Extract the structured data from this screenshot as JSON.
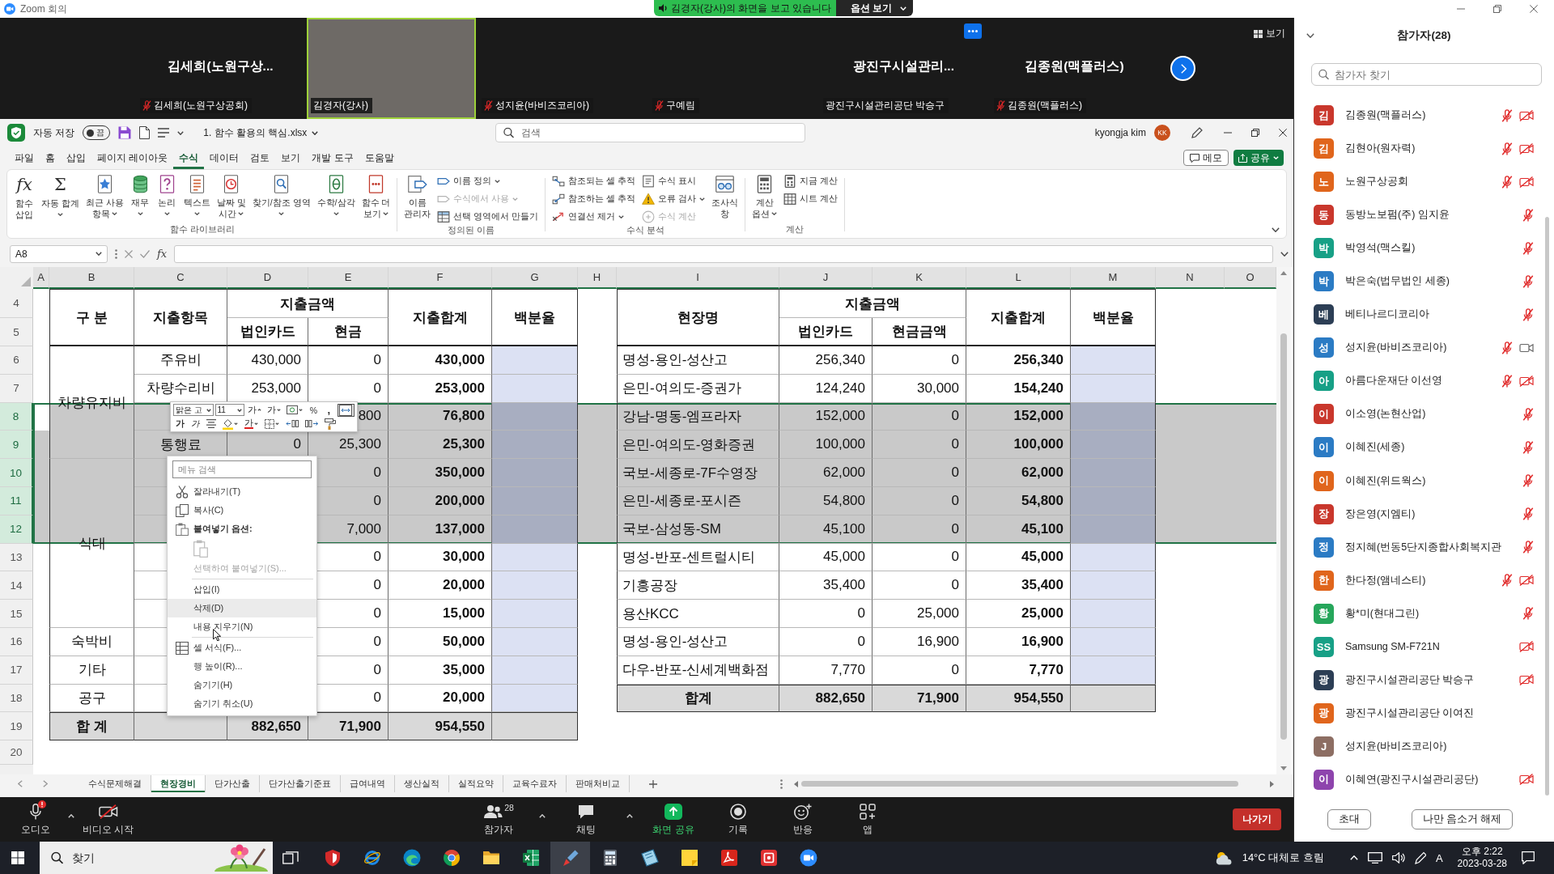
{
  "zoom_window": {
    "title": "Zoom 회의",
    "share_banner": "김경자(강사)의 화면을 보고 있습니다",
    "view_options": "옵션 보기"
  },
  "video_strip": {
    "tiles": [
      {
        "kind": "name",
        "display_name": "김세희(노원구상...",
        "label": "김세희(노원구상공회)",
        "muted": true,
        "speaking": false,
        "menu": false
      },
      {
        "kind": "video",
        "label": "김경자(강사)",
        "muted": false,
        "speaking": true,
        "menu": false
      },
      {
        "kind": "blank",
        "label": "성지윤(바비즈코리아)",
        "muted": true,
        "speaking": false,
        "menu": false
      },
      {
        "kind": "blank",
        "label": "구예림",
        "muted": true,
        "speaking": false,
        "menu": false
      },
      {
        "kind": "name",
        "display_name": "광진구시설관리...",
        "label": "광진구시설관리공단 박승구",
        "muted": false,
        "speaking": false,
        "menu": true
      },
      {
        "kind": "name",
        "display_name": "김종원(맥플러스)",
        "label": "김종원(맥플러스)",
        "muted": true,
        "speaking": false,
        "menu": false
      }
    ],
    "view_button": "보기"
  },
  "excel": {
    "autosave_label": "자동 저장",
    "autosave": {
      "label": "끔",
      "on": false
    },
    "file_name": "1. 함수 활용의 핵심.xlsx",
    "search_placeholder": "검색",
    "user_name": "kyongja kim",
    "user_initials": "KK",
    "tabs": [
      {
        "label": "파일",
        "selected": false
      },
      {
        "label": "홈",
        "selected": false
      },
      {
        "label": "삽입",
        "selected": false
      },
      {
        "label": "페이지 레이아웃",
        "selected": false
      },
      {
        "label": "수식",
        "selected": true
      },
      {
        "label": "데이터",
        "selected": false
      },
      {
        "label": "검토",
        "selected": false
      },
      {
        "label": "보기",
        "selected": false
      },
      {
        "label": "개발 도구",
        "selected": false
      },
      {
        "label": "도움말",
        "selected": false
      }
    ],
    "comments_button": "메모",
    "share_button": "공유",
    "ribbon": {
      "groups": [
        {
          "label": "함수 라이브러리",
          "items": [
            {
              "kind": "large",
              "glyph": "fx",
              "lines": [
                "함수",
                "삽입"
              ],
              "dropdown": false,
              "disabled": false
            },
            {
              "kind": "large",
              "glyph": "Σ",
              "lines": [
                "자동 합계"
              ],
              "dropdown": true,
              "disabled": false
            },
            {
              "kind": "large",
              "lines": [
                "최근 사용",
                "항목"
              ],
              "dropdown": true,
              "disabled": false
            },
            {
              "kind": "large",
              "lines": [
                "재무"
              ],
              "dropdown": true,
              "disabled": false
            },
            {
              "kind": "large",
              "lines": [
                "논리"
              ],
              "dropdown": true,
              "disabled": false
            },
            {
              "kind": "large",
              "lines": [
                "텍스트"
              ],
              "dropdown": true,
              "disabled": false
            },
            {
              "kind": "large",
              "lines": [
                "날짜 및",
                "시간"
              ],
              "dropdown": true,
              "disabled": false
            },
            {
              "kind": "large",
              "lines": [
                "찾기/참조 영역"
              ],
              "dropdown": true,
              "disabled": false
            },
            {
              "kind": "large",
              "lines": [
                "수학/삼각"
              ],
              "dropdown": true,
              "disabled": false
            },
            {
              "kind": "large",
              "lines": [
                "함수 더",
                "보기"
              ],
              "dropdown": true,
              "disabled": false
            }
          ]
        },
        {
          "label": "정의된 이름",
          "items": [
            {
              "kind": "large",
              "lines": [
                "이름",
                "관리자"
              ],
              "dropdown": false,
              "disabled": false
            },
            {
              "kind": "small",
              "label": "이름 정의",
              "dropdown": true,
              "disabled": false
            },
            {
              "kind": "small",
              "label": "수식에서 사용",
              "dropdown": true,
              "disabled": true
            },
            {
              "kind": "small",
              "label": "선택 영역에서 만들기",
              "dropdown": false,
              "disabled": false
            }
          ]
        },
        {
          "label": "수식 분석",
          "items": [
            {
              "kind": "small",
              "label": "참조되는 셀 추적",
              "dropdown": false,
              "disabled": false
            },
            {
              "kind": "small",
              "label": "참조하는 셀 추적",
              "dropdown": false,
              "disabled": false
            },
            {
              "kind": "small",
              "label": "연결선 제거",
              "dropdown": true,
              "disabled": false
            },
            {
              "kind": "small",
              "label": "수식 표시",
              "dropdown": false,
              "disabled": false
            },
            {
              "kind": "small",
              "label": "오류 검사",
              "dropdown": true,
              "disabled": false
            },
            {
              "kind": "small",
              "label": "수식 계산",
              "dropdown": false,
              "disabled": true
            },
            {
              "kind": "large",
              "lines": [
                "조사식",
                "창"
              ],
              "dropdown": false,
              "disabled": false
            }
          ]
        },
        {
          "label": "계산",
          "items": [
            {
              "kind": "large",
              "lines": [
                "계산",
                "옵션"
              ],
              "dropdown": true,
              "disabled": false
            },
            {
              "kind": "small",
              "label": "지금 계산",
              "dropdown": false,
              "disabled": false
            },
            {
              "kind": "small",
              "label": "시트 계산",
              "dropdown": false,
              "disabled": false
            }
          ]
        }
      ]
    },
    "name_box": "A8",
    "fx_label": "fx",
    "sheet": {
      "columns": [
        "A",
        "B",
        "C",
        "D",
        "E",
        "F",
        "G",
        "H",
        "I",
        "J",
        "K",
        "L",
        "M",
        "N",
        "O"
      ],
      "rows": [
        {
          "label": "4",
          "selected": false
        },
        {
          "label": "5",
          "selected": false
        },
        {
          "label": "6",
          "selected": false
        },
        {
          "label": "7",
          "selected": false
        },
        {
          "label": "8",
          "selected": true
        },
        {
          "label": "9",
          "selected": true
        },
        {
          "label": "10",
          "selected": true
        },
        {
          "label": "11",
          "selected": true
        },
        {
          "label": "12",
          "selected": true
        },
        {
          "label": "13",
          "selected": false
        },
        {
          "label": "14",
          "selected": false
        },
        {
          "label": "15",
          "selected": false
        },
        {
          "label": "16",
          "selected": false
        },
        {
          "label": "17",
          "selected": false
        },
        {
          "label": "18",
          "selected": false
        },
        {
          "label": "19",
          "selected": false
        },
        {
          "label": "20",
          "selected": false
        }
      ],
      "left_table": {
        "headers": {
          "category": "구 분",
          "item": "지출항목",
          "amount": "지출금액",
          "card": "법인카드",
          "cash": "현금",
          "total": "지출합계",
          "ratio": "백분율"
        },
        "groups": [
          {
            "label": "차량유지비",
            "rows": [
              {
                "item": "주유비",
                "card": "430,000",
                "cash": "0",
                "total": "430,000"
              },
              {
                "item": "차량수리비",
                "card": "253,000",
                "cash": "0",
                "total": "253,000"
              },
              {
                "cash": "800",
                "total": "76,800"
              },
              {
                "item": "통행료",
                "card": "0",
                "cash": "25,300",
                "total": "25,300"
              }
            ]
          },
          {
            "label": "식대",
            "rows": [
              {
                "cash": "0",
                "total": "350,000"
              },
              {
                "cash": "0",
                "total": "200,000"
              },
              {
                "cash": "7,000",
                "total": "137,000"
              },
              {
                "cash": "0",
                "total": "30,000"
              },
              {
                "cash": "0",
                "total": "20,000"
              },
              {
                "cash": "0",
                "total": "15,000"
              }
            ]
          },
          {
            "label": "숙박비",
            "rows": [
              {
                "cash": "0",
                "total": "50,000"
              }
            ]
          },
          {
            "label": "기타",
            "rows": [
              {
                "cash": "0",
                "total": "35,000"
              }
            ]
          },
          {
            "label": "공구",
            "rows": [
              {
                "cash": "0",
                "total": "20,000"
              }
            ]
          }
        ],
        "total": {
          "label": "합 계",
          "card": "882,650",
          "cash": "71,900",
          "total": "954,550"
        }
      },
      "right_table": {
        "headers": {
          "site": "현장명",
          "amount": "지출금액",
          "card": "법인카드",
          "cash": "현금금액",
          "total": "지출합계",
          "ratio": "백분율"
        },
        "rows": [
          {
            "site": "명성-용인-성산고",
            "card": "256,340",
            "cash": "0",
            "total": "256,340"
          },
          {
            "site": "은민-여의도-증권가",
            "card": "124,240",
            "cash": "30,000",
            "total": "154,240"
          },
          {
            "site": "강남-명동-엠프라자",
            "card": "152,000",
            "cash": "0",
            "total": "152,000"
          },
          {
            "site": "은민-여의도-영화증권",
            "card": "100,000",
            "cash": "0",
            "total": "100,000"
          },
          {
            "site": "국보-세종로-7F수영장",
            "card": "62,000",
            "cash": "0",
            "total": "62,000"
          },
          {
            "site": "은민-세종로-포시즌",
            "card": "54,800",
            "cash": "0",
            "total": "54,800"
          },
          {
            "site": "국보-삼성동-SM",
            "card": "45,100",
            "cash": "0",
            "total": "45,100"
          },
          {
            "site": "명성-반포-센트럴시티",
            "card": "45,000",
            "cash": "0",
            "total": "45,000"
          },
          {
            "site": "기흥공장",
            "card": "35,400",
            "cash": "0",
            "total": "35,400"
          },
          {
            "site": "용산KCC",
            "card": "0",
            "cash": "25,000",
            "total": "25,000"
          },
          {
            "site": "명성-용인-성산고",
            "card": "0",
            "cash": "16,900",
            "total": "16,900"
          },
          {
            "site": "다우-반포-신세계백화점",
            "card": "7,770",
            "cash": "0",
            "total": "7,770"
          }
        ],
        "total": {
          "label": "합계",
          "card": "882,650",
          "cash": "71,900",
          "total": "954,550"
        }
      }
    },
    "mini_toolbar": {
      "font": "맑은 고",
      "size": "11",
      "row1": [
        {
          "label": "가",
          "on": false
        },
        {
          "label": "가",
          "on": false
        },
        {
          "on": false
        },
        {
          "label": "%",
          "on": false
        },
        {
          "label": ",",
          "on": false
        },
        {
          "on": true
        }
      ],
      "row2": [
        {
          "label": "가",
          "on": false
        },
        {
          "label": "가",
          "on": false
        },
        {
          "on": false
        },
        {
          "on": false
        },
        {
          "label": "가",
          "on": false
        },
        {
          "on": false
        },
        {
          "on": false
        },
        {
          "on": false
        },
        {
          "on": false
        }
      ]
    },
    "context_menu": {
      "items": [
        {
          "kind": "search",
          "placeholder": "메뉴 검색"
        },
        {
          "kind": "cut",
          "label": "잘라내기(T)",
          "disabled": false,
          "highlighted": false
        },
        {
          "kind": "copy",
          "label": "복사(C)",
          "disabled": false,
          "highlighted": false
        },
        {
          "kind": "paste-header",
          "label": "붙여넣기 옵션:",
          "disabled": false,
          "highlighted": false
        },
        {
          "kind": "paste-button",
          "disabled": true
        },
        {
          "kind": "command",
          "label": "선택하여 붙여넣기(S)...",
          "disabled": true,
          "highlighted": false
        },
        {
          "kind": "separator"
        },
        {
          "kind": "command",
          "label": "삽입(I)",
          "disabled": false,
          "highlighted": false
        },
        {
          "kind": "command",
          "label": "삭제(D)",
          "disabled": false,
          "highlighted": true
        },
        {
          "kind": "command",
          "label": "내용 지우기(N)",
          "disabled": false,
          "highlighted": false
        },
        {
          "kind": "separator"
        },
        {
          "kind": "format",
          "label": "셀 서식(F)...",
          "disabled": false,
          "highlighted": false
        },
        {
          "kind": "command",
          "label": "행 높이(R)...",
          "disabled": false,
          "highlighted": false
        },
        {
          "kind": "command",
          "label": "숨기기(H)",
          "disabled": false,
          "highlighted": false
        },
        {
          "kind": "command",
          "label": "숨기기 취소(U)",
          "disabled": false,
          "highlighted": false
        }
      ]
    },
    "sheet_tabs": [
      {
        "label": "수식문제해결",
        "selected": false
      },
      {
        "label": "현장경비",
        "selected": true
      },
      {
        "label": "단가산출",
        "selected": false
      },
      {
        "label": "단가산출기준표",
        "selected": false
      },
      {
        "label": "급여내역",
        "selected": false
      },
      {
        "label": "생산실적",
        "selected": false
      },
      {
        "label": "실적요약",
        "selected": false
      },
      {
        "label": "교육수료자",
        "selected": false
      },
      {
        "label": "판매처비교",
        "selected": false
      }
    ]
  },
  "meeting_controls": {
    "left": [
      {
        "kind": "audio",
        "label": "오디오",
        "menu": true
      },
      {
        "kind": "video",
        "label": "비디오 시작",
        "menu": false
      }
    ],
    "center": [
      {
        "kind": "participants",
        "label": "참가자",
        "count": "28",
        "menu": true
      },
      {
        "kind": "chat",
        "label": "채팅",
        "menu": true
      },
      {
        "kind": "share",
        "label": "화면 공유",
        "menu": false
      },
      {
        "kind": "record",
        "label": "기록",
        "menu": false
      },
      {
        "kind": "reactions",
        "label": "반응",
        "menu": false
      },
      {
        "kind": "apps",
        "label": "앱",
        "menu": false
      }
    ],
    "leave_button": "나가기"
  },
  "participants_panel": {
    "title": "참가자(28)",
    "search_placeholder": "참가자 찾기",
    "participants": [
      {
        "initial": "김",
        "name": "김종원(맥플러스)",
        "color": "#c9372c",
        "muted": true,
        "video_off": true,
        "video_on": false
      },
      {
        "initial": "김",
        "name": "김현아(원자력)",
        "color": "#e0651c",
        "muted": true,
        "video_off": true,
        "video_on": false
      },
      {
        "initial": "노",
        "name": "노원구상공회",
        "color": "#e0651c",
        "muted": true,
        "video_off": true,
        "video_on": false
      },
      {
        "initial": "동",
        "name": "동방노보펌(주) 임지윤",
        "color": "#c9372c",
        "muted": true,
        "video_off": false,
        "video_on": false
      },
      {
        "initial": "박",
        "name": "박영석(맥스킬)",
        "color": "#17a086",
        "muted": true,
        "video_off": false,
        "video_on": false
      },
      {
        "initial": "박",
        "name": "박은숙(법무법인 세종)",
        "color": "#2b7bc4",
        "muted": true,
        "video_off": false,
        "video_on": false
      },
      {
        "initial": "베",
        "name": "베티나르디코리아",
        "color": "#2c3e55",
        "muted": true,
        "video_off": false,
        "video_on": false
      },
      {
        "initial": "성",
        "name": "성지윤(바비즈코리아)",
        "color": "#2b7bc4",
        "muted": true,
        "video_off": false,
        "video_on": true
      },
      {
        "initial": "아",
        "name": "아름다운재단 이선영",
        "color": "#17a086",
        "muted": true,
        "video_off": true,
        "video_on": false
      },
      {
        "initial": "이",
        "name": "이소영(논현산업)",
        "color": "#c9372c",
        "muted": true,
        "video_off": false,
        "video_on": false
      },
      {
        "initial": "이",
        "name": "이혜진(세종)",
        "color": "#2b7bc4",
        "muted": true,
        "video_off": false,
        "video_on": false
      },
      {
        "initial": "이",
        "name": "이혜진(위드웍스)",
        "color": "#e0651c",
        "muted": true,
        "video_off": false,
        "video_on": false
      },
      {
        "initial": "장",
        "name": "장은영(지엠티)",
        "color": "#c9372c",
        "muted": true,
        "video_off": false,
        "video_on": false
      },
      {
        "initial": "정",
        "name": "정지혜(번동5단지종합사회복지관",
        "color": "#2b7bc4",
        "muted": true,
        "video_off": false,
        "video_on": false
      },
      {
        "initial": "한",
        "name": "한다정(앰네스티)",
        "color": "#e0651c",
        "muted": true,
        "video_off": true,
        "video_on": false
      },
      {
        "initial": "황",
        "name": "황*미(현대그린)",
        "color": "#26a65b",
        "muted": true,
        "video_off": false,
        "video_on": false
      },
      {
        "initial": "SS",
        "name": "Samsung SM-F721N",
        "color": "#17a086",
        "muted": false,
        "video_off": true,
        "video_on": false
      },
      {
        "initial": "광",
        "name": "광진구시설관리공단 박승구",
        "color": "#2c3e55",
        "muted": false,
        "video_off": true,
        "video_on": false
      },
      {
        "initial": "광",
        "name": "광진구시설관리공단 이여진",
        "color": "#e0651c",
        "muted": false,
        "video_off": false,
        "video_on": false
      },
      {
        "initial": "J",
        "name": "성지윤(바비즈코리아)",
        "color": "#8d6e63",
        "muted": false,
        "video_off": false,
        "video_on": false
      },
      {
        "initial": "이",
        "name": "이혜연(광진구시설관리공단)",
        "color": "#8e44ad",
        "muted": false,
        "video_off": true,
        "video_on": false
      }
    ],
    "buttons": [
      "초대",
      "나만 음소거 해제"
    ]
  },
  "taskbar": {
    "search_placeholder": "찾기",
    "apps": [
      {
        "active": false
      },
      {
        "active": false
      },
      {
        "active": false
      },
      {
        "active": false
      },
      {
        "active": false
      },
      {
        "active": false
      },
      {
        "active": true
      },
      {
        "active": false
      },
      {
        "active": false
      },
      {
        "active": false
      },
      {
        "active": false
      },
      {
        "active": false
      },
      {
        "active": false
      }
    ],
    "weather": "14°C 대체로 흐림",
    "ime": "A",
    "time": "오후 2:22",
    "date": "2023-03-28"
  }
}
